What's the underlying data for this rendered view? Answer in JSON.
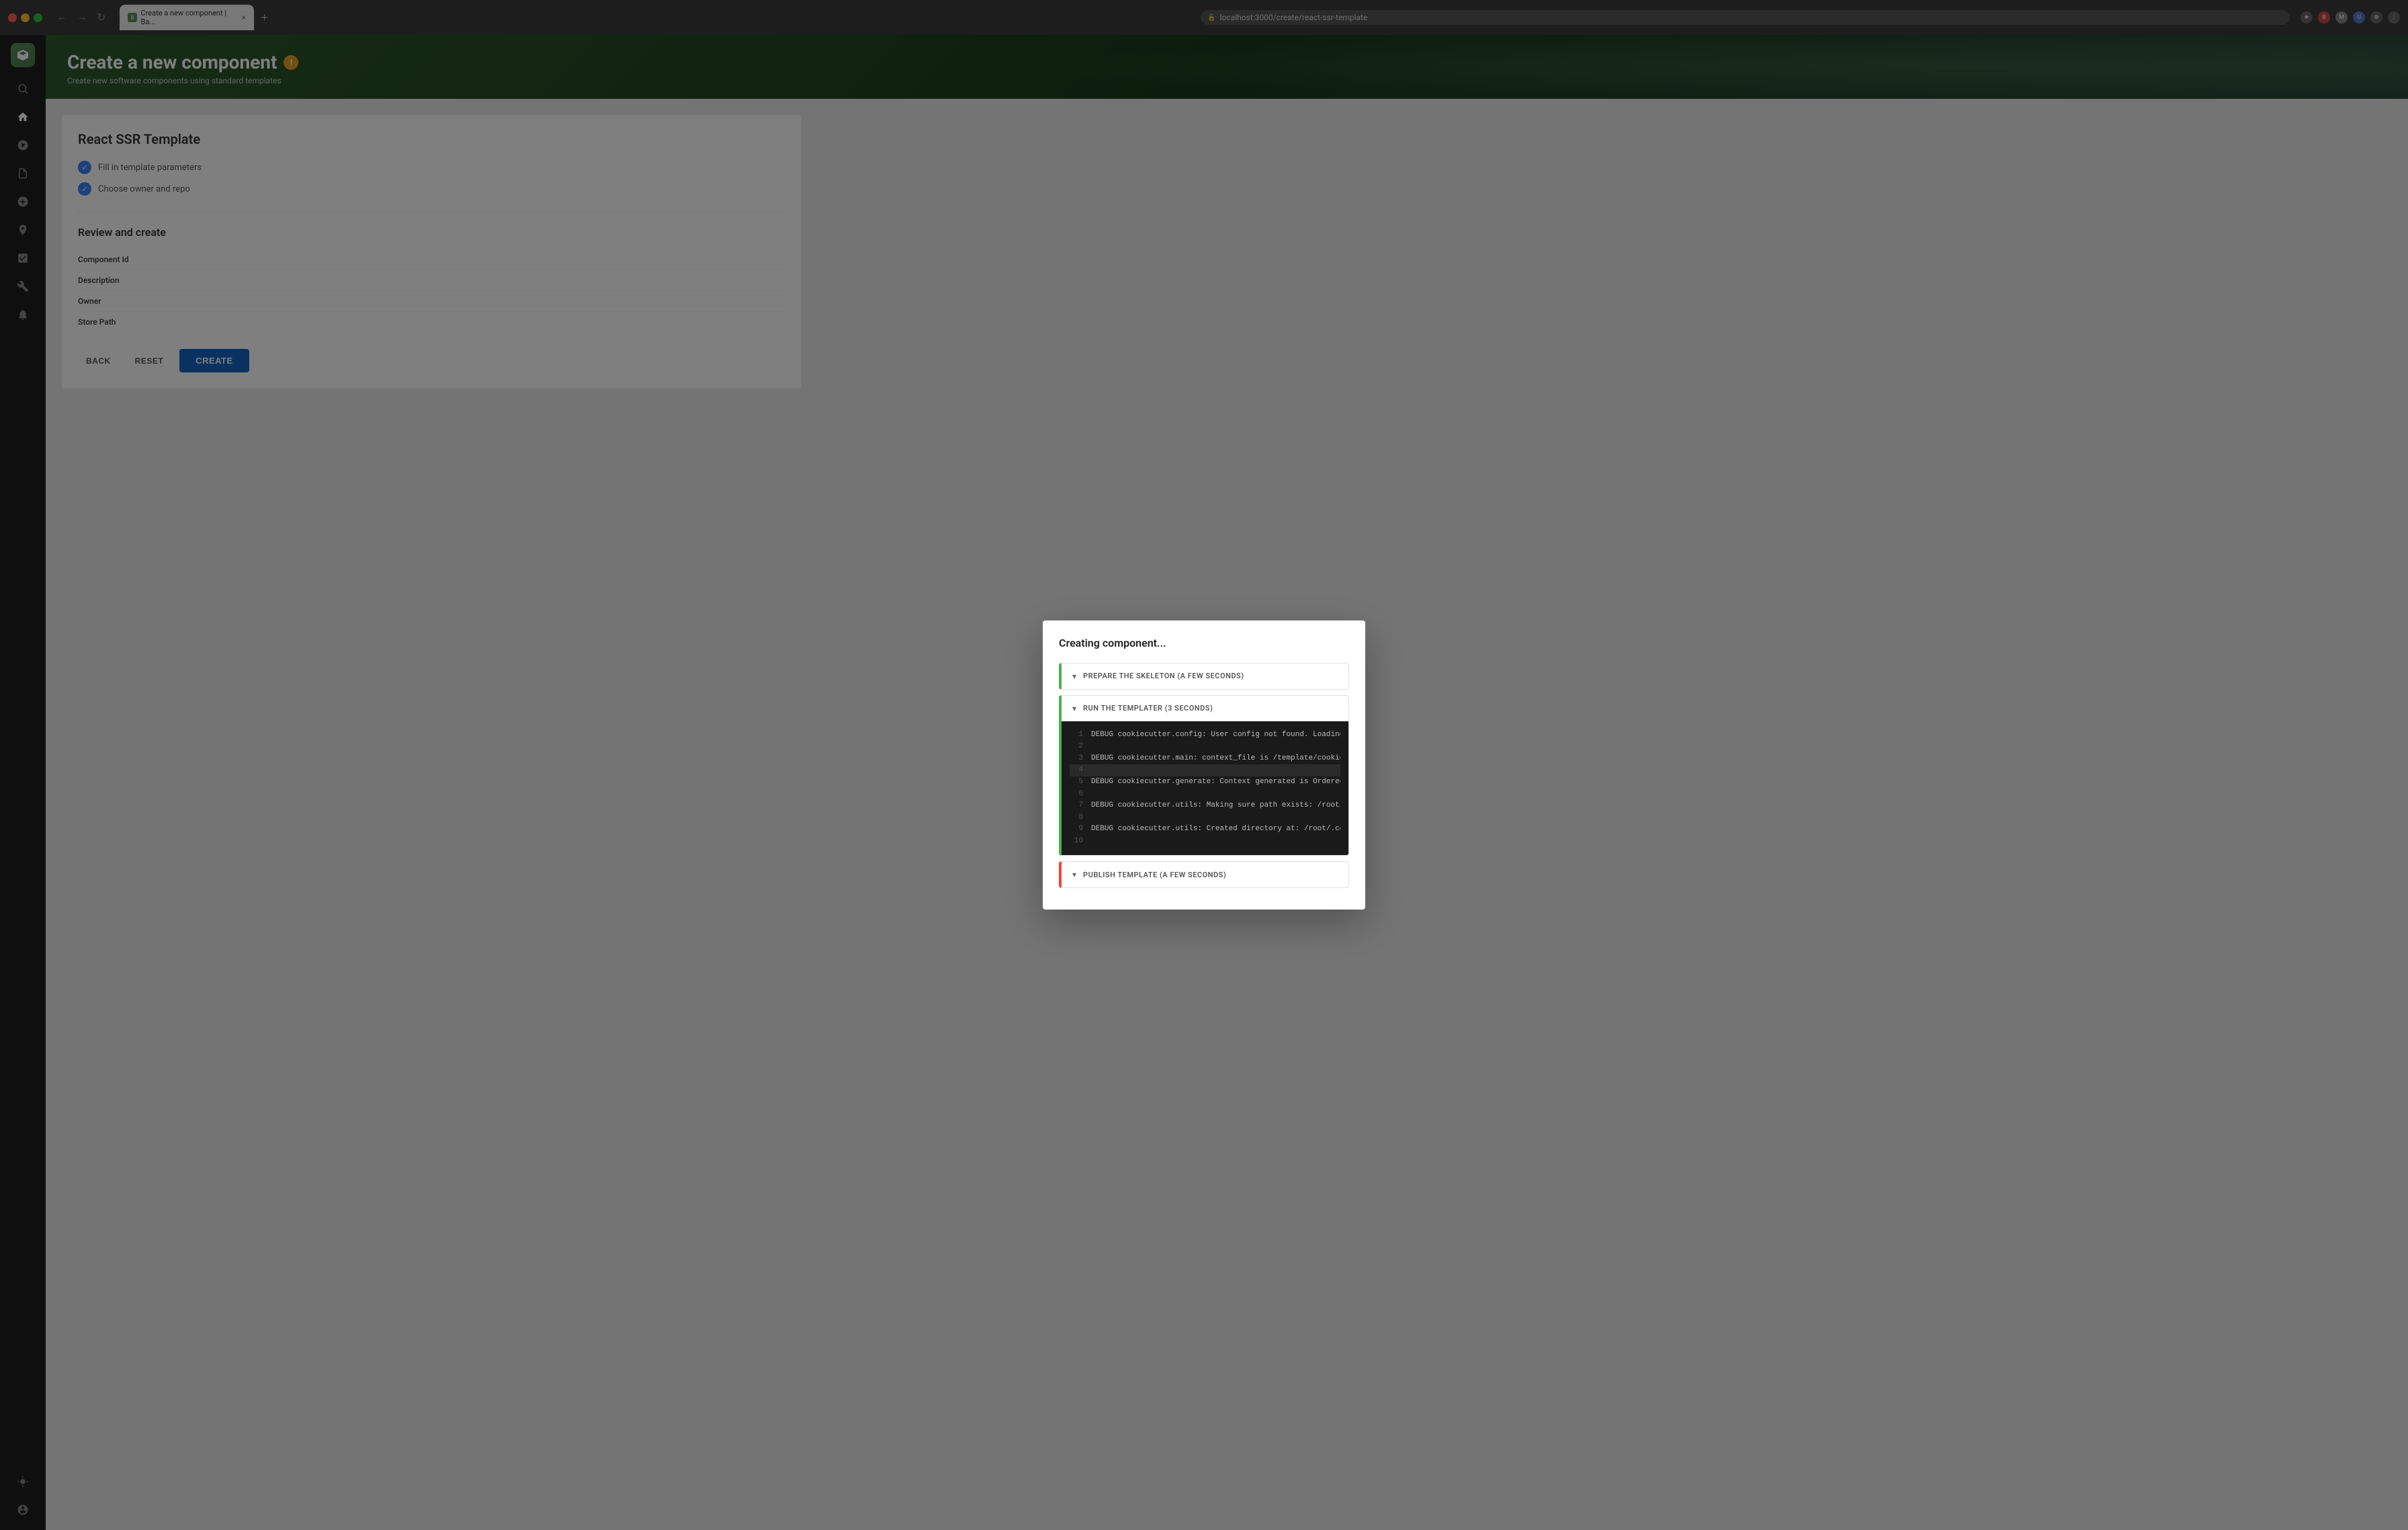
{
  "browser": {
    "tab_label": "Create a new component | Ba...",
    "tab_close": "×",
    "new_tab": "+",
    "nav_back": "←",
    "nav_forward": "→",
    "nav_refresh": "↻",
    "address": "localhost:3000/create/react-ssr-template",
    "favicon_text": "B"
  },
  "sidebar": {
    "logo_alt": "Backstage logo",
    "items": [
      {
        "name": "home",
        "icon": "home"
      },
      {
        "name": "explore",
        "icon": "compass"
      },
      {
        "name": "docs",
        "icon": "document"
      },
      {
        "name": "add",
        "icon": "plus"
      },
      {
        "name": "location",
        "icon": "location"
      },
      {
        "name": "tasks",
        "icon": "check-square"
      },
      {
        "name": "settings",
        "icon": "wrench"
      },
      {
        "name": "notifications",
        "icon": "bell"
      }
    ],
    "bottom_items": [
      {
        "name": "theme",
        "icon": "sun"
      },
      {
        "name": "user",
        "icon": "user-circle"
      }
    ]
  },
  "page": {
    "header_title": "Create a new component",
    "header_icon": "!",
    "header_subtitle": "Create new software components using standard templates",
    "card_title": "React SSR Template"
  },
  "steps": [
    {
      "label": "Fill in template parameters",
      "completed": true
    },
    {
      "label": "Choose owner and repo",
      "completed": true
    }
  ],
  "review": {
    "title": "Review and create",
    "fields": [
      {
        "label": "Component Id"
      },
      {
        "label": "Description"
      },
      {
        "label": "Owner"
      },
      {
        "label": "Store Path"
      }
    ]
  },
  "buttons": {
    "back": "BACK",
    "reset": "RESET",
    "create": "CREATE"
  },
  "modal": {
    "title": "Creating component...",
    "accordion_items": [
      {
        "label": "PREPARE THE SKELETON (A FEW SECONDS)",
        "border_color": "green",
        "expanded": false
      },
      {
        "label": "RUN THE TEMPLATER (3 SECONDS)",
        "border_color": "green",
        "expanded": true,
        "terminal_lines": [
          {
            "num": "1",
            "text": "DEBUG cookiecutter.config: User config not found. Loading default",
            "highlight": false
          },
          {
            "num": "2",
            "text": "",
            "highlight": false
          },
          {
            "num": "3",
            "text": "DEBUG cookiecutter.main: context_file is /template/cookiecutter.j",
            "highlight": false
          },
          {
            "num": "4",
            "text": "",
            "highlight": true
          },
          {
            "num": "5",
            "text": "DEBUG cookiecutter.generate: Context generated is OrderedDict([[cu",
            "highlight": false
          },
          {
            "num": "6",
            "text": "",
            "highlight": false
          },
          {
            "num": "7",
            "text": "DEBUG cookiecutter.utils: Making sure path exists: /root/.cookiec",
            "highlight": false
          },
          {
            "num": "8",
            "text": "",
            "highlight": false
          },
          {
            "num": "9",
            "text": "DEBUG cookiecutter.utils: Created directory at: /root/.cookiecutt",
            "highlight": false
          },
          {
            "num": "10",
            "text": "",
            "highlight": false
          }
        ]
      },
      {
        "label": "PUBLISH TEMPLATE (A FEW SECONDS)",
        "border_color": "red",
        "expanded": false
      }
    ]
  }
}
